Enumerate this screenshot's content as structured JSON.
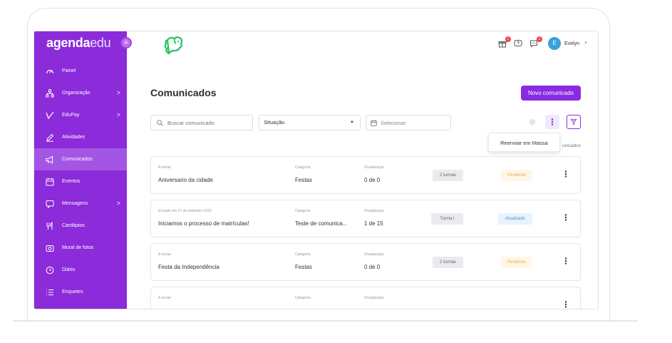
{
  "brand": {
    "bold": "agenda",
    "light": "edu"
  },
  "sidebar": {
    "items": [
      {
        "label": "Painel",
        "icon": "gauge-icon",
        "chevron": ""
      },
      {
        "label": "Organização",
        "icon": "org-chart-icon",
        "chevron": ">"
      },
      {
        "label": "EduPay",
        "icon": "edupay-icon",
        "chevron": ">"
      },
      {
        "label": "Atividades",
        "icon": "pencil-icon",
        "chevron": ""
      },
      {
        "label": "Comunicados",
        "icon": "megaphone-icon",
        "chevron": ""
      },
      {
        "label": "Eventos",
        "icon": "calendar-icon",
        "chevron": ""
      },
      {
        "label": "Mensagens",
        "icon": "message-icon",
        "chevron": ">"
      },
      {
        "label": "Cardápios",
        "icon": "utensils-icon",
        "chevron": ""
      },
      {
        "label": "Mural de fotos",
        "icon": "camera-icon",
        "chevron": ""
      },
      {
        "label": "Diário",
        "icon": "clock-icon",
        "chevron": ""
      },
      {
        "label": "Enquetes",
        "icon": "list-icon",
        "chevron": ""
      }
    ],
    "active_index": 4
  },
  "header": {
    "user_initial": "E",
    "user_name": "Evelyn",
    "badge_gift": "1",
    "badge_chat": "1"
  },
  "page": {
    "title": "Comunicados",
    "new_button": "Novo comunicado",
    "search_placeholder": "Buscar comunicado",
    "situacao_label": "Situação",
    "date_placeholder": "Selecionar",
    "popup_label": "Reenviar em Massa",
    "count_text": "unicados"
  },
  "cards": [
    {
      "status_label": "A enviar",
      "title": "Aniversario da cidade",
      "category_label": "Categoria",
      "category": "Festas",
      "views_label": "Visualização",
      "views": "0 de 0",
      "turma": "2 turmas",
      "situation": "Pendente",
      "situation_type": "pend"
    },
    {
      "status_label": "Enviado em 27 de setembro 2022",
      "title": "Iniciamos o processo de matrículas!",
      "category_label": "Categoria",
      "category": "Teste de comunica...",
      "views_label": "Visualização",
      "views": "1 de 15",
      "turma": "Turma I",
      "situation": "Atualizado",
      "situation_type": "atual"
    },
    {
      "status_label": "A enviar",
      "title": "Festa da Independência",
      "category_label": "Categoria",
      "category": "Festas",
      "views_label": "Visualização",
      "views": "0 de 0",
      "turma": "2 turmas",
      "situation": "Pendente",
      "situation_type": "pend"
    },
    {
      "status_label": "A enviar",
      "title": "",
      "category_label": "Categoria",
      "category": "",
      "views_label": "Visualização",
      "views": "",
      "turma": "",
      "situation": "",
      "situation_type": "pend"
    }
  ],
  "colors": {
    "brand_purple": "#8b2bd9",
    "active_item": "#a356e4",
    "button_purple": "#8a2be2",
    "logo_green": "#22c55e"
  }
}
